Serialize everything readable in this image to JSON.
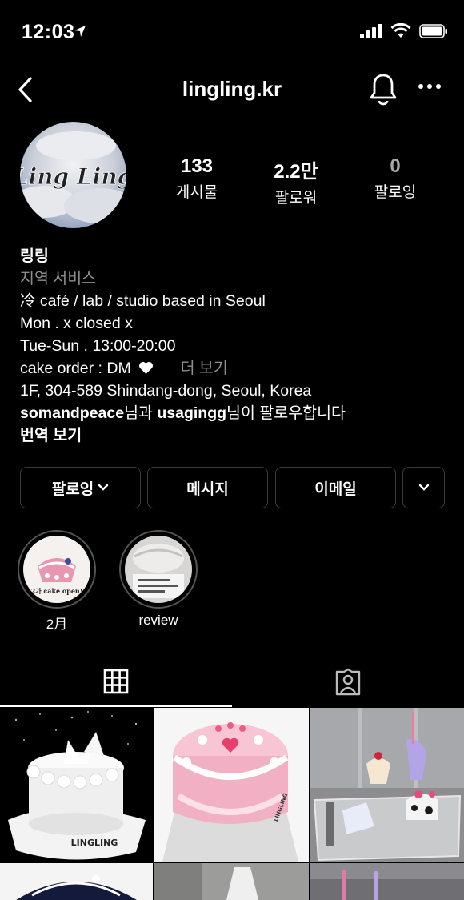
{
  "status": {
    "time": "12:03"
  },
  "header": {
    "username": "lingling.kr"
  },
  "avatar": {
    "logo_text": "Ling Ling"
  },
  "stats": [
    {
      "value": "133",
      "label": "게시물"
    },
    {
      "value": "2.2만",
      "label": "팔로워"
    },
    {
      "value": "0",
      "label": "팔로잉"
    }
  ],
  "bio": {
    "name": "링링",
    "category": "지역 서비스",
    "lines": [
      "冷 café / lab / studio based in Seoul",
      "Mon . x closed x",
      "Tue-Sun . 13:00-20:00",
      "cake order : DM"
    ],
    "more": "더 보기",
    "address": "1F, 304-589 Shindang-dong, Seoul, Korea",
    "followed_user1": "somandpeace",
    "followed_mid": "님과 ",
    "followed_user2": "usagingg",
    "followed_end": "님이 팔로우합니다",
    "translate": "번역 보기"
  },
  "buttons": {
    "follow": "팔로잉",
    "message": "메시지",
    "email": "이메일"
  },
  "highlights": [
    {
      "label": "2月",
      "caption": "2가 cake open!"
    },
    {
      "label": "review"
    }
  ],
  "grid": {
    "brand_1": "LINGLING",
    "brand_2": "LINGLING"
  },
  "colors": {
    "background": "#000000",
    "secondary_text": "#8e8e8e",
    "border": "#3a3a3a"
  }
}
